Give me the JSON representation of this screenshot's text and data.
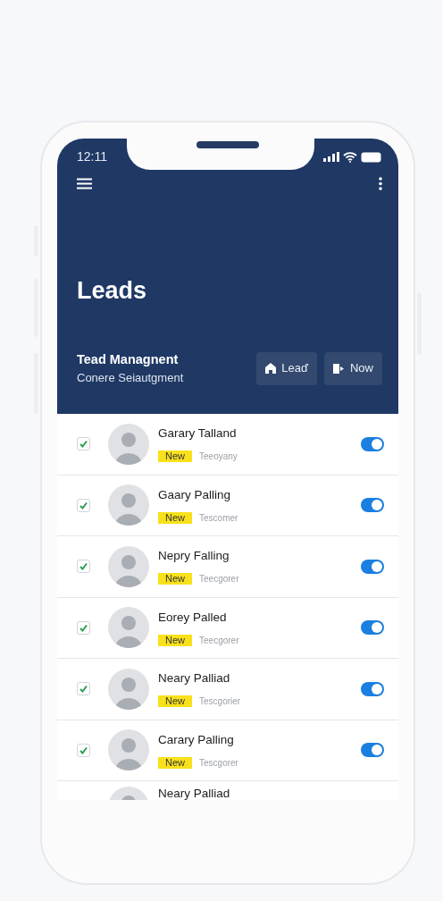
{
  "status_bar": {
    "time": "12:11"
  },
  "header": {
    "title": "Leads",
    "subtitle": "Tead Managnent",
    "caption": "Conere Seiautgment",
    "buttons": [
      {
        "label": "Leaď",
        "kind": "home"
      },
      {
        "label": "Now",
        "kind": "door"
      }
    ]
  },
  "leads": [
    {
      "name": "Garary Talland",
      "tag": "New",
      "detail": "Teeoyany",
      "checked": true,
      "on": true
    },
    {
      "name": "Gaary Palling",
      "tag": "New",
      "detail": "Tescomer",
      "checked": true,
      "on": true
    },
    {
      "name": "Nepry Falling",
      "tag": "New",
      "detail": "Teecgorer",
      "checked": true,
      "on": true
    },
    {
      "name": "Eorey Palled",
      "tag": "New",
      "detail": "Teecgorer",
      "checked": true,
      "on": true
    },
    {
      "name": "Neary Palliad",
      "tag": "New",
      "detail": "Tescgorier",
      "checked": true,
      "on": true
    },
    {
      "name": "Carary Palling",
      "tag": "New",
      "detail": "Tescgorer",
      "checked": true,
      "on": true
    },
    {
      "name": "Neary Palliad"
    }
  ]
}
